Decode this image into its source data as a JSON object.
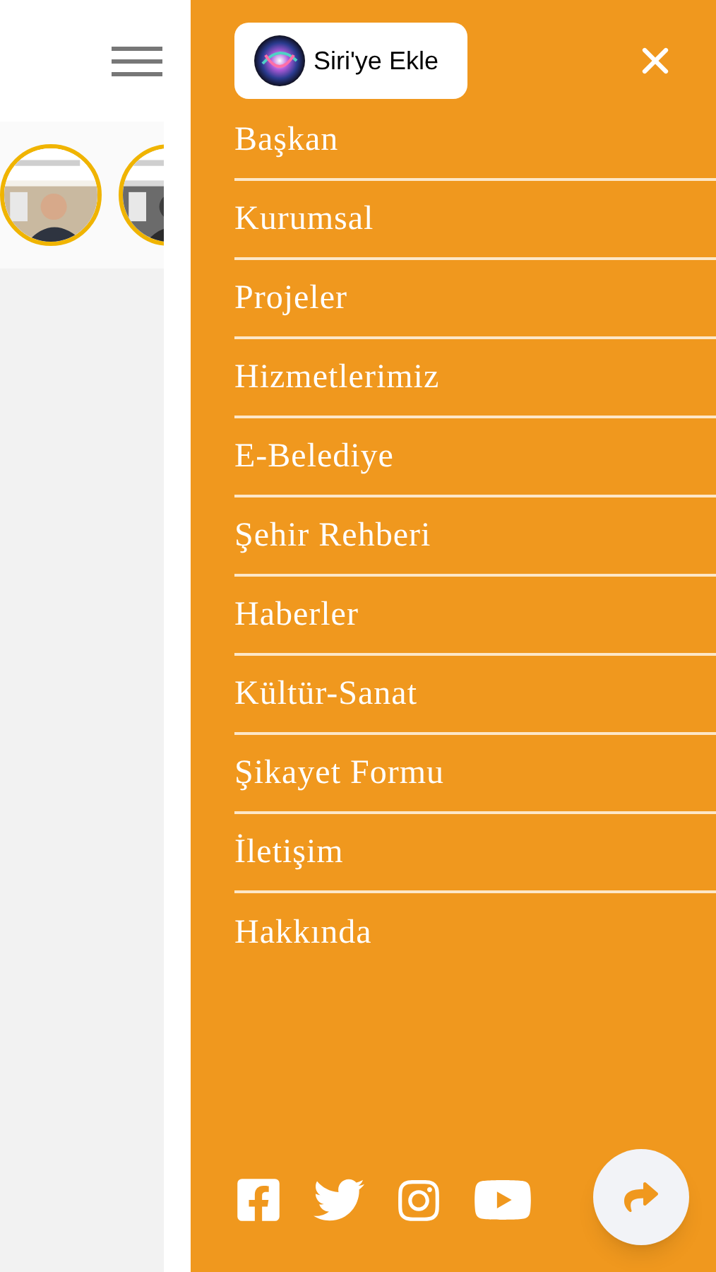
{
  "menu": {
    "siri_button": "Siri'ye Ekle",
    "items": [
      "Başkan",
      "Kurumsal",
      "Projeler",
      "Hizmetlerimiz",
      "E-Belediye",
      "Şehir Rehberi",
      "Haberler",
      "Kültür-Sanat",
      "Şikayet Formu",
      "İletişim",
      "Hakkında"
    ]
  }
}
